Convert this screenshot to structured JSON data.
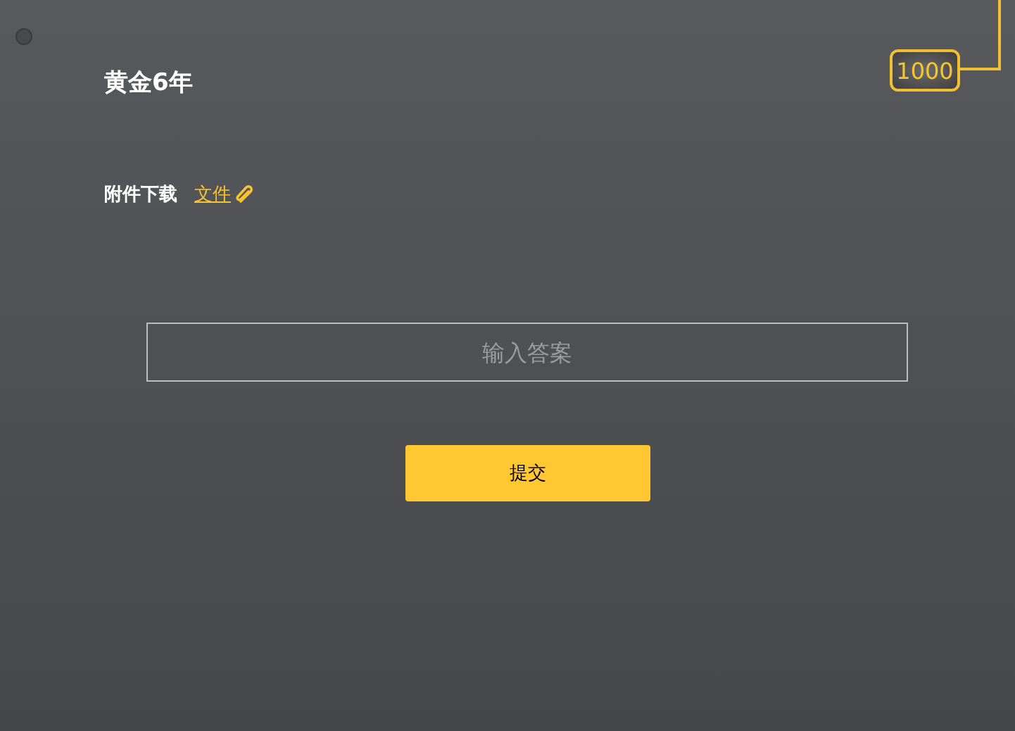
{
  "title": "黄金6年",
  "attachment": {
    "label": "附件下载",
    "link": "文件"
  },
  "answer": {
    "placeholder": "输入答案"
  },
  "submit": {
    "label": "提交"
  },
  "score": {
    "value": "1000"
  }
}
